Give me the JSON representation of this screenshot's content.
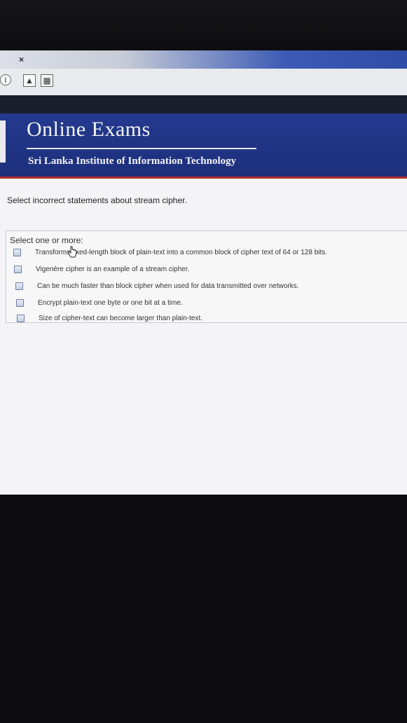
{
  "browser": {
    "tab_close": "×",
    "icons": [
      "info-icon",
      "pdf-icon",
      "calculator-icon"
    ]
  },
  "banner": {
    "title": "Online Exams",
    "subtitle": "Sri Lanka Institute of Information Technology"
  },
  "question": {
    "text": "Select incorrect statements about stream cipher.",
    "prompt": "Select one or more:",
    "options": [
      "Transforms fixed-length block of plain-text into a common block of cipher text of 64 or 128 bits.",
      "Vigenère cipher is an example of a stream cipher.",
      "Can be much faster than block cipher when used for data transmitted over networks.",
      "Encrypt plain-text one byte or one bit at a time.",
      "Size of cipher-text can become larger than plain-text."
    ]
  },
  "colors": {
    "banner_blue": "#243a8f",
    "banner_accent_red": "#b22c2c",
    "page_background": "#f4f4f6"
  }
}
